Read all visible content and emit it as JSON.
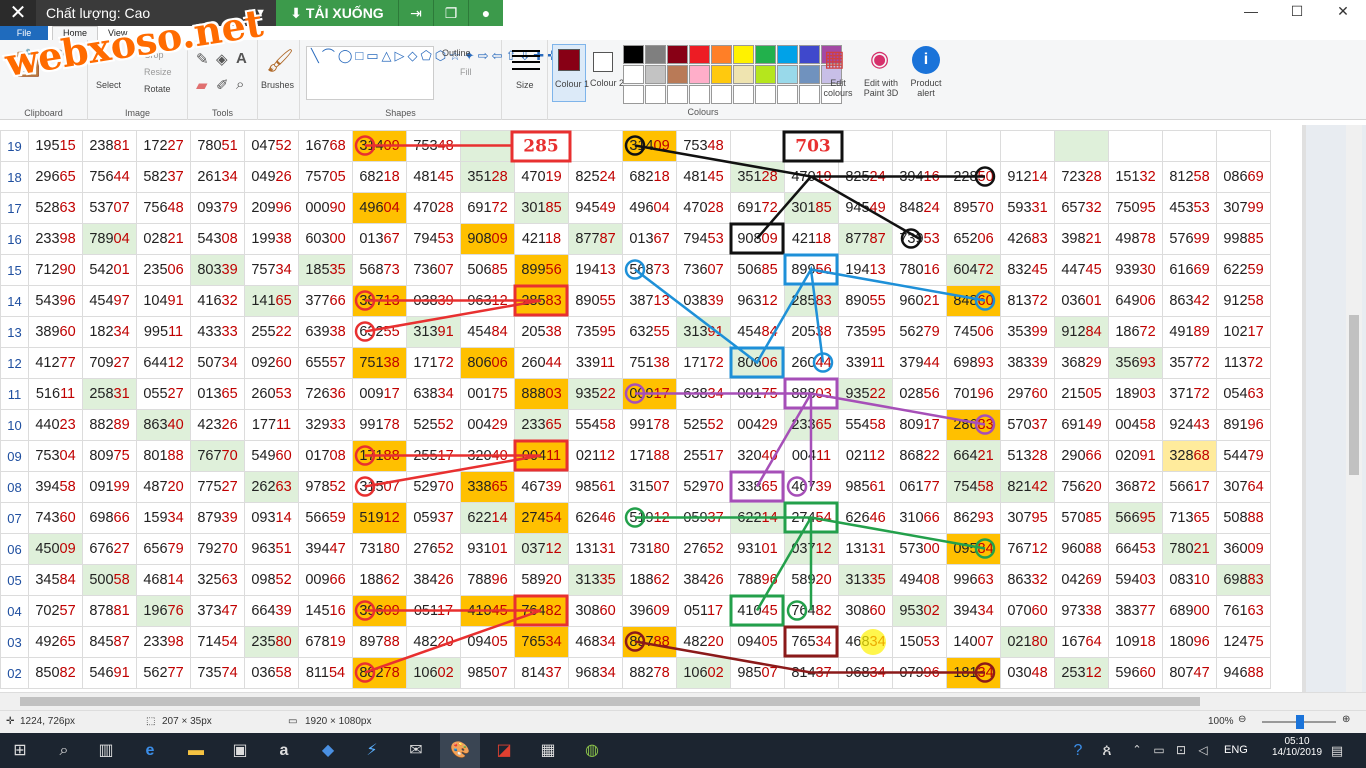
{
  "overlay": {
    "quality_label": "Chất lượng: Cao",
    "download_label": "TẢI XUỐNG"
  },
  "ribbon": {
    "tabs": [
      "File",
      "Home",
      "View"
    ],
    "crop": "Crop",
    "resize": "Resize",
    "rotate": "Rotate",
    "select": "Select",
    "brushes": "Brushes",
    "outline": "Outline",
    "fill": "Fill",
    "size": "Size",
    "colour1": "Colour 1",
    "colour2": "Colour 2",
    "edit_colours": "Edit colours",
    "edit_paint3d": "Edit with Paint 3D",
    "product_alert": "Product alert",
    "groups": {
      "clipboard": "Clipboard",
      "image": "Image",
      "tools": "Tools",
      "shapes": "Shapes",
      "colours": "Colours"
    }
  },
  "palette": [
    "#000000",
    "#7f7f7f",
    "#880015",
    "#ed1c24",
    "#ff7f27",
    "#fff200",
    "#22b14c",
    "#00a2e8",
    "#3f48cc",
    "#a349a4",
    "#ffffff",
    "#c3c3c3",
    "#b97a57",
    "#ffaec9",
    "#ffc90e",
    "#efe4b0",
    "#b5e61d",
    "#99d9ea",
    "#7092be",
    "#c8bfe7",
    "#ffffff",
    "#ffffff",
    "#ffffff",
    "#ffffff",
    "#ffffff",
    "#ffffff",
    "#ffffff",
    "#ffffff",
    "#ffffff",
    "#ffffff"
  ],
  "watermark": "webxoso.net",
  "annotations": {
    "box1": "285",
    "box2": "703"
  },
  "grid": {
    "rows": [
      {
        "label": "19",
        "cells": [
          "19515",
          "23881",
          "17227",
          "78051",
          "04752",
          "16768",
          "31409",
          "75348",
          "",
          "",
          "",
          "31409",
          "75348",
          "",
          "",
          "",
          "",
          "",
          "",
          "",
          "",
          "",
          ""
        ]
      },
      {
        "label": "18",
        "cells": [
          "29665",
          "75644",
          "58237",
          "26134",
          "04926",
          "75705",
          "68218",
          "48145",
          "35128",
          "47019",
          "82524",
          "68218",
          "48145",
          "35128",
          "47019",
          "82524",
          "39416",
          "22850",
          "91214",
          "72328",
          "15132",
          "81258",
          "08669"
        ]
      },
      {
        "label": "17",
        "cells": [
          "52863",
          "53707",
          "75648",
          "09379",
          "20996",
          "00090",
          "49604",
          "47028",
          "69172",
          "30185",
          "94549",
          "49604",
          "47028",
          "69172",
          "30185",
          "94549",
          "84824",
          "89570",
          "59331",
          "65732",
          "75095",
          "45353",
          "30799"
        ]
      },
      {
        "label": "16",
        "cells": [
          "23398",
          "78904",
          "02821",
          "54308",
          "19938",
          "60300",
          "01367",
          "79453",
          "90809",
          "42118",
          "87787",
          "01367",
          "79453",
          "90809",
          "42118",
          "87787",
          "73953",
          "65206",
          "42683",
          "39821",
          "49878",
          "57699",
          "99885"
        ]
      },
      {
        "label": "15",
        "cells": [
          "71290",
          "54201",
          "23506",
          "80339",
          "75734",
          "18535",
          "56873",
          "73607",
          "50685",
          "89956",
          "19413",
          "56873",
          "73607",
          "50685",
          "89956",
          "19413",
          "78016",
          "60472",
          "83245",
          "44745",
          "93930",
          "61669",
          "62259"
        ]
      },
      {
        "label": "14",
        "cells": [
          "54396",
          "45497",
          "10491",
          "41632",
          "14165",
          "37766",
          "38713",
          "03839",
          "96312",
          "28583",
          "89055",
          "38713",
          "03839",
          "96312",
          "28583",
          "89055",
          "96021",
          "84860",
          "81372",
          "03601",
          "64906",
          "86342",
          "91258"
        ]
      },
      {
        "label": "13",
        "cells": [
          "38960",
          "18234",
          "99511",
          "43333",
          "25522",
          "63938",
          "63255",
          "31391",
          "45484",
          "20538",
          "73595",
          "63255",
          "31391",
          "45484",
          "20538",
          "73595",
          "56279",
          "74506",
          "35399",
          "91284",
          "18672",
          "49189",
          "10217"
        ]
      },
      {
        "label": "12",
        "cells": [
          "41277",
          "70927",
          "64412",
          "50734",
          "09260",
          "65557",
          "75138",
          "17172",
          "80606",
          "26044",
          "33911",
          "75138",
          "17172",
          "80606",
          "26044",
          "33911",
          "37944",
          "69893",
          "38339",
          "36829",
          "35693",
          "35772",
          "11372"
        ]
      },
      {
        "label": "11",
        "cells": [
          "51611",
          "25831",
          "05527",
          "01365",
          "26053",
          "72636",
          "00917",
          "63834",
          "00175",
          "88803",
          "93522",
          "00917",
          "63834",
          "00175",
          "88803",
          "93522",
          "02856",
          "70196",
          "29760",
          "21505",
          "18903",
          "37172",
          "05463"
        ]
      },
      {
        "label": "10",
        "cells": [
          "44023",
          "88289",
          "86340",
          "42326",
          "17711",
          "32933",
          "99178",
          "52552",
          "00429",
          "23365",
          "55458",
          "99178",
          "52552",
          "00429",
          "23365",
          "55458",
          "80917",
          "28683",
          "57037",
          "69149",
          "00458",
          "92443",
          "89196"
        ]
      },
      {
        "label": "09",
        "cells": [
          "75304",
          "80975",
          "80188",
          "76770",
          "54960",
          "01708",
          "17188",
          "25517",
          "32040",
          "00411",
          "02112",
          "17188",
          "25517",
          "32040",
          "00411",
          "02112",
          "86822",
          "66421",
          "51328",
          "29066",
          "02091",
          "32868",
          "54479"
        ]
      },
      {
        "label": "08",
        "cells": [
          "39458",
          "09199",
          "48720",
          "77527",
          "26263",
          "97852",
          "31507",
          "52970",
          "33865",
          "46739",
          "98561",
          "31507",
          "52970",
          "33865",
          "46739",
          "98561",
          "06177",
          "75458",
          "82142",
          "75620",
          "36872",
          "56617",
          "30764"
        ]
      },
      {
        "label": "07",
        "cells": [
          "74360",
          "69866",
          "15934",
          "87939",
          "09314",
          "56659",
          "51912",
          "05937",
          "62214",
          "27454",
          "62646",
          "51912",
          "05937",
          "62214",
          "27454",
          "62646",
          "31066",
          "86293",
          "30795",
          "57085",
          "56695",
          "71365",
          "50888"
        ]
      },
      {
        "label": "06",
        "cells": [
          "45009",
          "67627",
          "65679",
          "79270",
          "96351",
          "39447",
          "73180",
          "27652",
          "93101",
          "03712",
          "13131",
          "73180",
          "27652",
          "93101",
          "03712",
          "13131",
          "57300",
          "09584",
          "76712",
          "96088",
          "66453",
          "78021",
          "36009"
        ]
      },
      {
        "label": "05",
        "cells": [
          "34584",
          "50058",
          "46814",
          "32563",
          "09852",
          "00966",
          "18862",
          "38426",
          "78896",
          "58920",
          "31335",
          "18862",
          "38426",
          "78896",
          "58920",
          "31335",
          "49408",
          "99663",
          "86332",
          "04269",
          "59403",
          "08310",
          "69883"
        ]
      },
      {
        "label": "04",
        "cells": [
          "70257",
          "87881",
          "19676",
          "37347",
          "66439",
          "14516",
          "39609",
          "05117",
          "41045",
          "76482",
          "30860",
          "39609",
          "05117",
          "41045",
          "76482",
          "30860",
          "95302",
          "39434",
          "07060",
          "97338",
          "38377",
          "68900",
          "76163"
        ]
      },
      {
        "label": "03",
        "cells": [
          "49265",
          "84587",
          "23398",
          "71454",
          "23580",
          "67819",
          "89788",
          "48220",
          "09405",
          "76534",
          "46834",
          "89788",
          "48220",
          "09405",
          "76534",
          "46834",
          "15053",
          "14007",
          "02180",
          "16764",
          "10918",
          "18096",
          "12475"
        ]
      },
      {
        "label": "02",
        "cells": [
          "85082",
          "54691",
          "56277",
          "73574",
          "03658",
          "81154",
          "88278",
          "10602",
          "98507",
          "81437",
          "96834",
          "88278",
          "10602",
          "98507",
          "81437",
          "96834",
          "07996",
          "18134",
          "03048",
          "25312",
          "59660",
          "80747",
          "94688"
        ]
      }
    ]
  },
  "status": {
    "cursor": "1224, 726px",
    "selection": "207 × 35px",
    "image_size": "1920 × 1080px",
    "zoom": "100%"
  },
  "taskbar": {
    "lang": "ENG",
    "time": "05:10",
    "date": "14/10/2019"
  }
}
